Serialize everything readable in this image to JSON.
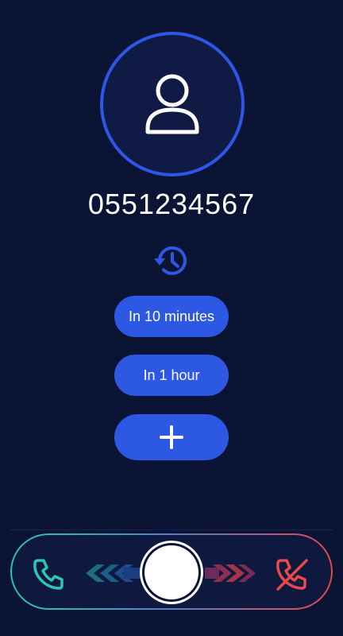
{
  "caller": {
    "number": "0551234567",
    "avatar_icon": "person-icon"
  },
  "snooze": {
    "icon": "history-clock-icon",
    "options": [
      {
        "label": "In 10 minutes"
      },
      {
        "label": "In 1 hour"
      }
    ],
    "add_icon": "plus-icon"
  },
  "slider": {
    "accept_icon": "phone-icon",
    "decline_icon": "phone-decline-icon",
    "accept_color": "#2bc7b4",
    "decline_color": "#e84a4a"
  },
  "colors": {
    "background": "#0c1436",
    "accent": "#2c58e4"
  }
}
